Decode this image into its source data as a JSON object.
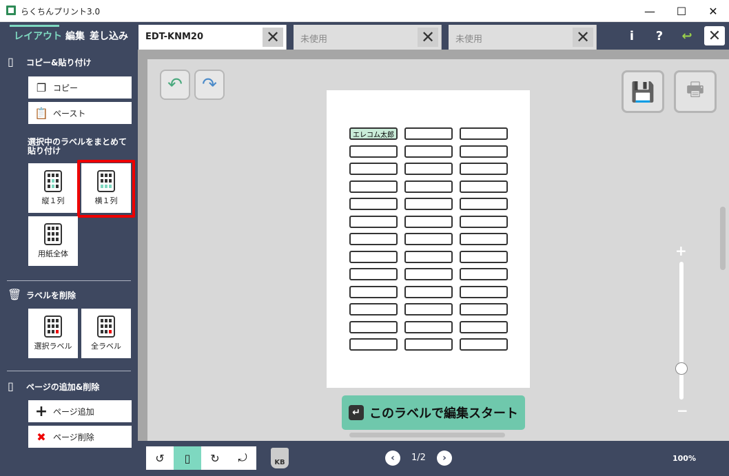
{
  "window": {
    "title": "らくちんプリント3.0",
    "minimize": "—",
    "maximize": "☐",
    "close": "✕"
  },
  "modes": [
    "レイアウト",
    "編集",
    "差し込み"
  ],
  "tabs": [
    {
      "label": "EDT-KNM20",
      "close": "✕"
    },
    {
      "label": "未使用",
      "close": "✕"
    },
    {
      "label": "未使用",
      "close": "✕"
    }
  ],
  "toolbar": {
    "info": "i",
    "help": "?",
    "back": "↩",
    "close": "✕"
  },
  "sidebar": {
    "copy_section": "コピー&貼り付け",
    "copy_label": "コピー",
    "paste_label": "ペースト",
    "bulk_paste_title": "選択中のラベルをまとめて貼り付け",
    "tiles_paste": [
      "縦１列",
      "横１列",
      "用紙全体"
    ],
    "delete_section": "ラベルを削除",
    "tiles_delete": [
      "選択ラベル",
      "全ラベル"
    ],
    "page_section": "ページの追加&削除",
    "page_add": "ページ追加",
    "page_delete": "ページ削除"
  },
  "canvas": {
    "first_label_text": "エレコム太郎",
    "label_rows": 13,
    "label_cols": 3,
    "start_button": "このラベルで編集スタート"
  },
  "bottom": {
    "page": "1/2",
    "kb": "KB",
    "zoom": "100%"
  },
  "colors": {
    "accent": "#7ed8c0",
    "panel": "#3e4860",
    "highlight": "#e00000"
  }
}
